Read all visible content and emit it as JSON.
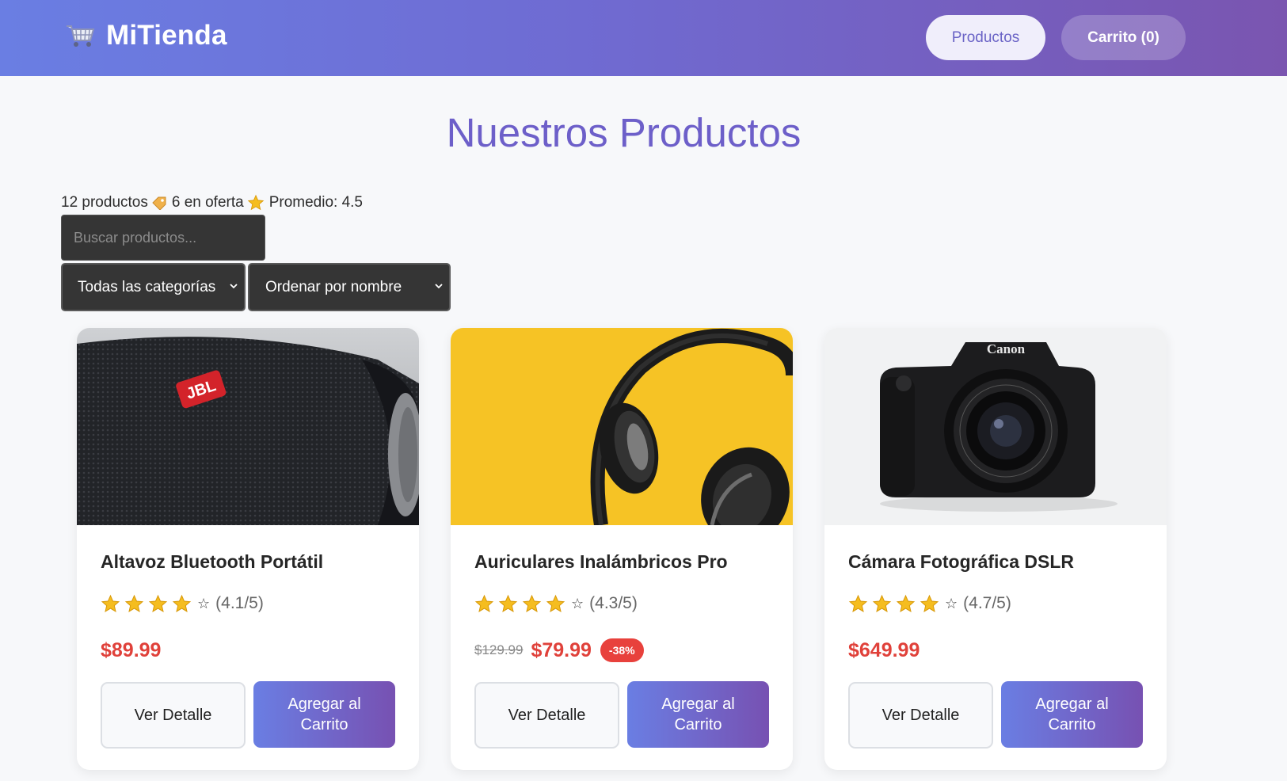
{
  "header": {
    "brand": "MiTienda",
    "nav": {
      "products_label": "Productos",
      "cart_label": "Carrito (0)"
    }
  },
  "page_title": "Nuestros Productos",
  "stats": {
    "products_text": "12 productos",
    "offers_text": "6 en oferta",
    "average_text": "Promedio: 4.5"
  },
  "filters": {
    "search_placeholder": "Buscar productos...",
    "category_selected": "Todas las categorías",
    "sort_selected": "Ordenar por nombre"
  },
  "colors": {
    "accent": "#6d5fc9",
    "price": "#e0413a",
    "header_start": "#6a7ee3",
    "header_end": "#7a55b0"
  },
  "products": [
    {
      "name": "Altavoz Bluetooth Portátil",
      "rating_text": "(4.1/5)",
      "filled_stars": 4,
      "old_price": "",
      "price": "$89.99",
      "discount": "",
      "detail_label": "Ver Detalle",
      "add_label": "Agregar al Carrito",
      "image_icon": "jbl-speaker-photo"
    },
    {
      "name": "Auriculares Inalámbricos Pro",
      "rating_text": "(4.3/5)",
      "filled_stars": 4,
      "old_price": "$129.99",
      "price": "$79.99",
      "discount": "-38%",
      "detail_label": "Ver Detalle",
      "add_label": "Agregar al Carrito",
      "image_icon": "headphones-photo"
    },
    {
      "name": "Cámara Fotográfica DSLR",
      "rating_text": "(4.7/5)",
      "filled_stars": 4,
      "old_price": "",
      "price": "$649.99",
      "discount": "",
      "detail_label": "Ver Detalle",
      "add_label": "Agregar al Carrito",
      "image_icon": "canon-camera-photo"
    }
  ],
  "image_labels": {
    "speaker_logo": "JBL",
    "camera_brand": "Canon"
  }
}
